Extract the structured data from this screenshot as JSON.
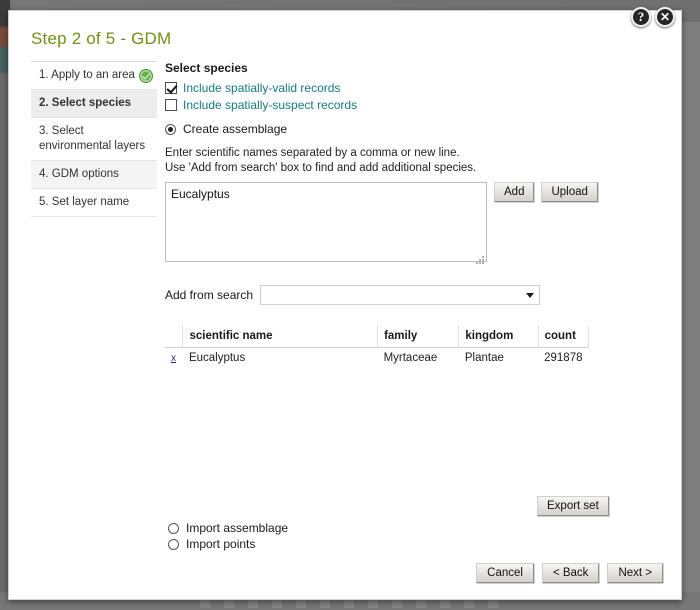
{
  "window": {
    "help_icon": "question-mark-icon",
    "help_label": "?",
    "close_icon": "close-icon",
    "close_label": "✕"
  },
  "title": "Step 2 of 5 - GDM",
  "sidebar": {
    "items": [
      {
        "label": "1. Apply to an area",
        "complete": true
      },
      {
        "label": "2. Select species",
        "complete": false
      },
      {
        "label": "3. Select environmental layers",
        "complete": false
      },
      {
        "label": "4. GDM options",
        "complete": false
      },
      {
        "label": "5. Set layer name",
        "complete": false
      }
    ]
  },
  "main": {
    "section_title": "Select species",
    "checkboxes": [
      {
        "label": "Include spatially-valid records",
        "checked": true
      },
      {
        "label": "Include spatially-suspect records",
        "checked": false
      }
    ],
    "create_assemblage": {
      "label": "Create assemblage",
      "selected": true
    },
    "hint_line1": "Enter scientific names separated by a comma or new line.",
    "hint_line2": "Use 'Add from search' box to find and add additional species.",
    "textarea": {
      "value": "Eucalyptus",
      "placeholder": ""
    },
    "add_label": "Add",
    "upload_label": "Upload",
    "search": {
      "label": "Add from search",
      "value": "",
      "placeholder": "",
      "arrow_icon": "chevron-down-icon"
    },
    "table": {
      "headers": [
        "",
        "scientific name",
        "family",
        "kingdom",
        "count"
      ],
      "rows": [
        {
          "delete": "x",
          "scientific_name": "Eucalyptus",
          "family": "Myrtaceae",
          "kingdom": "Plantae",
          "count": "291878"
        }
      ]
    },
    "export_label": "Export set",
    "import_options": [
      {
        "label": "Import assemblage",
        "selected": false
      },
      {
        "label": "Import points",
        "selected": false
      }
    ]
  },
  "footer": {
    "cancel_label": "Cancel",
    "back_label": "< Back",
    "next_label": "Next >"
  },
  "colors": {
    "title": "#6f8f17",
    "link": "#177a7c",
    "check_green": "#64b244"
  }
}
